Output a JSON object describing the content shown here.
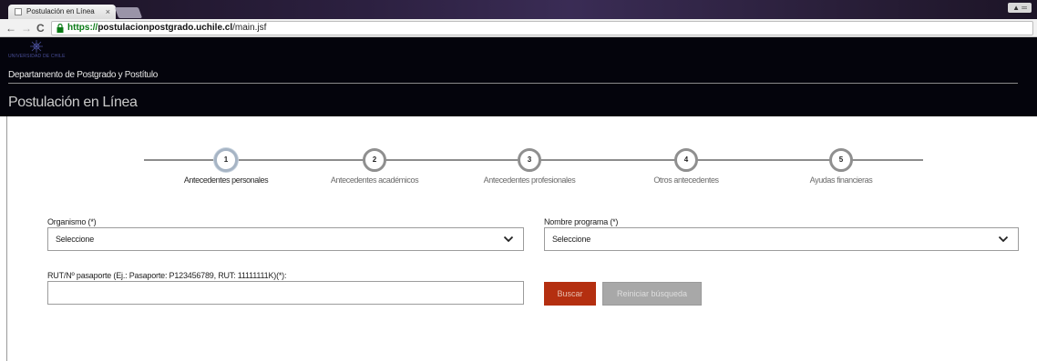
{
  "browser": {
    "tab_title": "Postulación en Línea",
    "tab_close": "×",
    "url_secure": "https://",
    "url_host": "postulacionpostgrado.uchile.cl",
    "url_path": "/main.jsf",
    "back": "←",
    "forward": "→",
    "reload": "C",
    "window_control": "▲ ═"
  },
  "header": {
    "logo_text": "UNIVERSIDAD DE CHILE",
    "department": "Departamento de Postgrado y Postítulo",
    "page_title": "Postulación en Línea"
  },
  "stepper": {
    "steps": [
      {
        "number": "1",
        "label": "Antecedentes personales",
        "active": true
      },
      {
        "number": "2",
        "label": "Antecedentes académicos",
        "active": false
      },
      {
        "number": "3",
        "label": "Antecedentes profesionales",
        "active": false
      },
      {
        "number": "4",
        "label": "Otros antecedentes",
        "active": false
      },
      {
        "number": "5",
        "label": "Ayudas financieras",
        "active": false
      }
    ]
  },
  "form": {
    "organismo_label": "Organismo (*)",
    "organismo_value": "Seleccione",
    "programa_label": "Nombre programa (*)",
    "programa_value": "Seleccione",
    "rut_label": "RUT/Nº pasaporte (Ej.: Pasaporte: P123456789, RUT: 11111111K)(*):",
    "rut_value": "",
    "search_button": "Buscar",
    "reset_button": "Reiniciar búsqueda"
  },
  "colors": {
    "header_bg": "#04040c",
    "primary_button": "#b42f10",
    "secondary_button": "#a8a8a8"
  }
}
